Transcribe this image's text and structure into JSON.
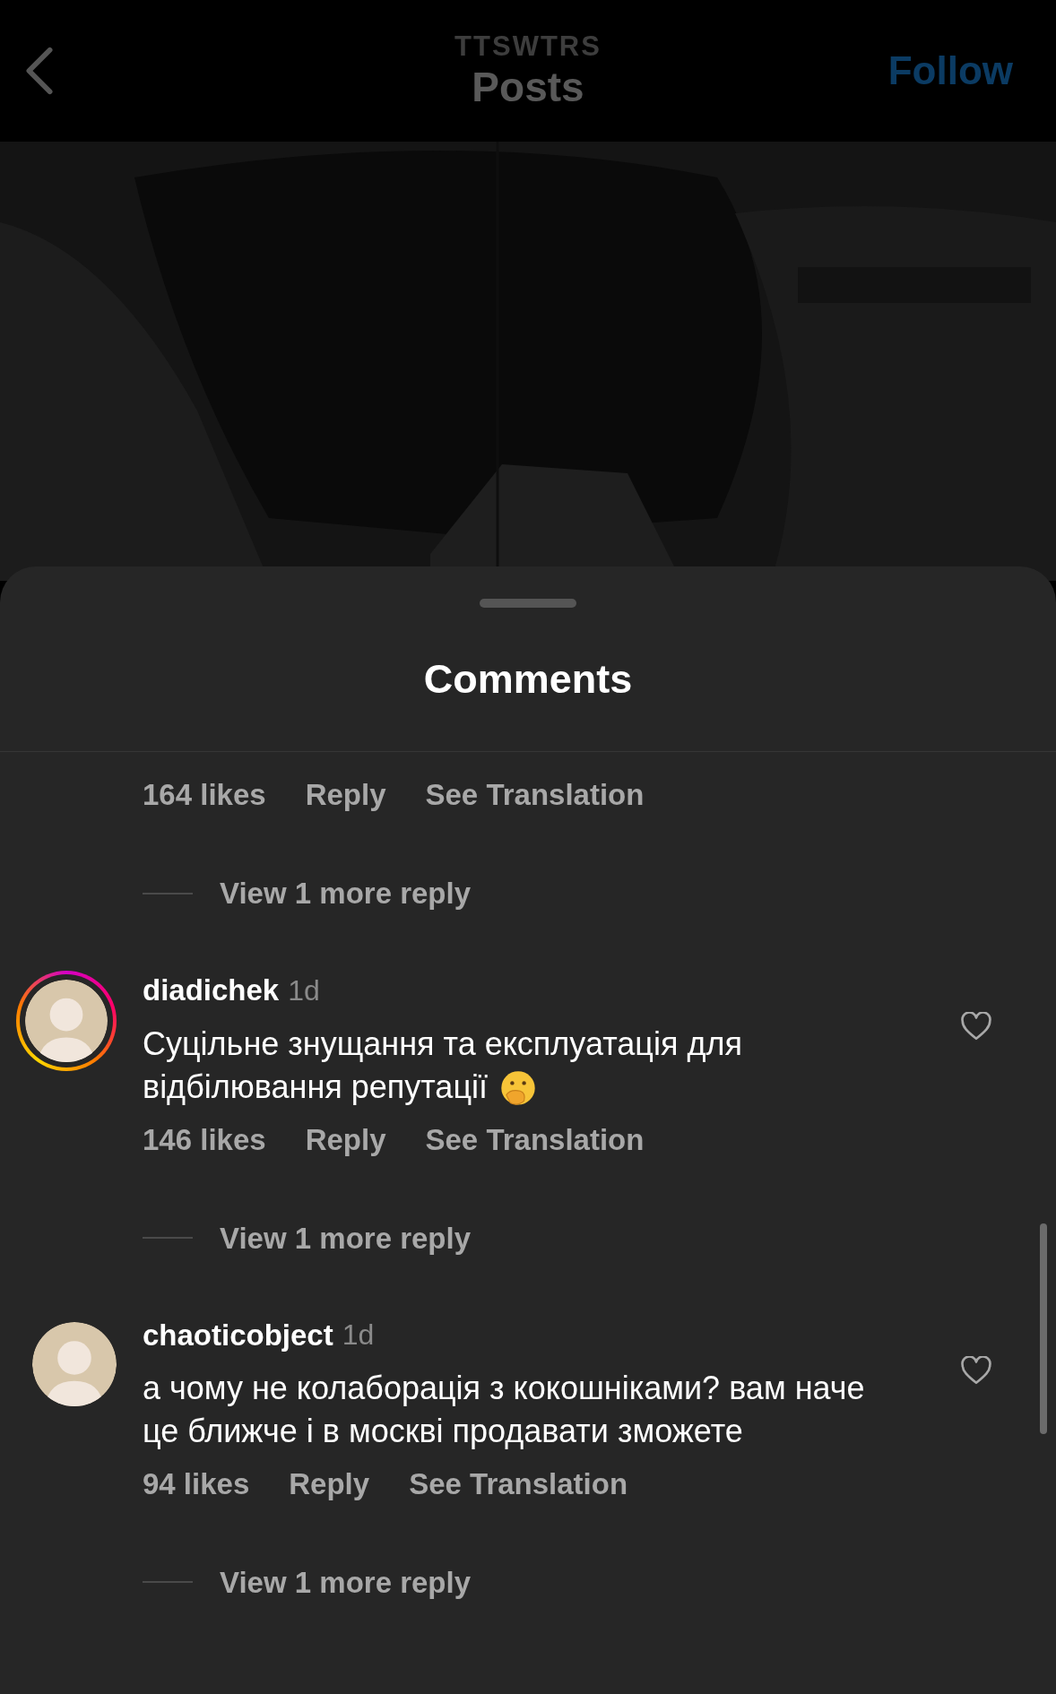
{
  "header": {
    "account": "TTSWTRS",
    "title": "Posts",
    "follow": "Follow"
  },
  "sheet": {
    "title": "Comments"
  },
  "comments": [
    {
      "kind": "partial",
      "likes": "164 likes",
      "reply": "Reply",
      "translate": "See Translation",
      "more": "View 1 more reply"
    },
    {
      "kind": "full",
      "username": "diadichek",
      "time": "1d",
      "text": "Суцільне знущання та експлуатація для відбілювання репутації",
      "emoji": true,
      "story_ring": true,
      "liked": false,
      "likes": "146 likes",
      "reply": "Reply",
      "translate": "See Translation",
      "more": "View 1 more reply"
    },
    {
      "kind": "full",
      "username": "chaoticobject",
      "time": "1d",
      "text": "а чому не колаборація з кокошніками? вам наче це ближче і в москві продавати зможете",
      "emoji": false,
      "story_ring": false,
      "liked": false,
      "likes": "94 likes",
      "reply": "Reply",
      "translate": "See Translation",
      "more": "View 1 more reply"
    }
  ]
}
